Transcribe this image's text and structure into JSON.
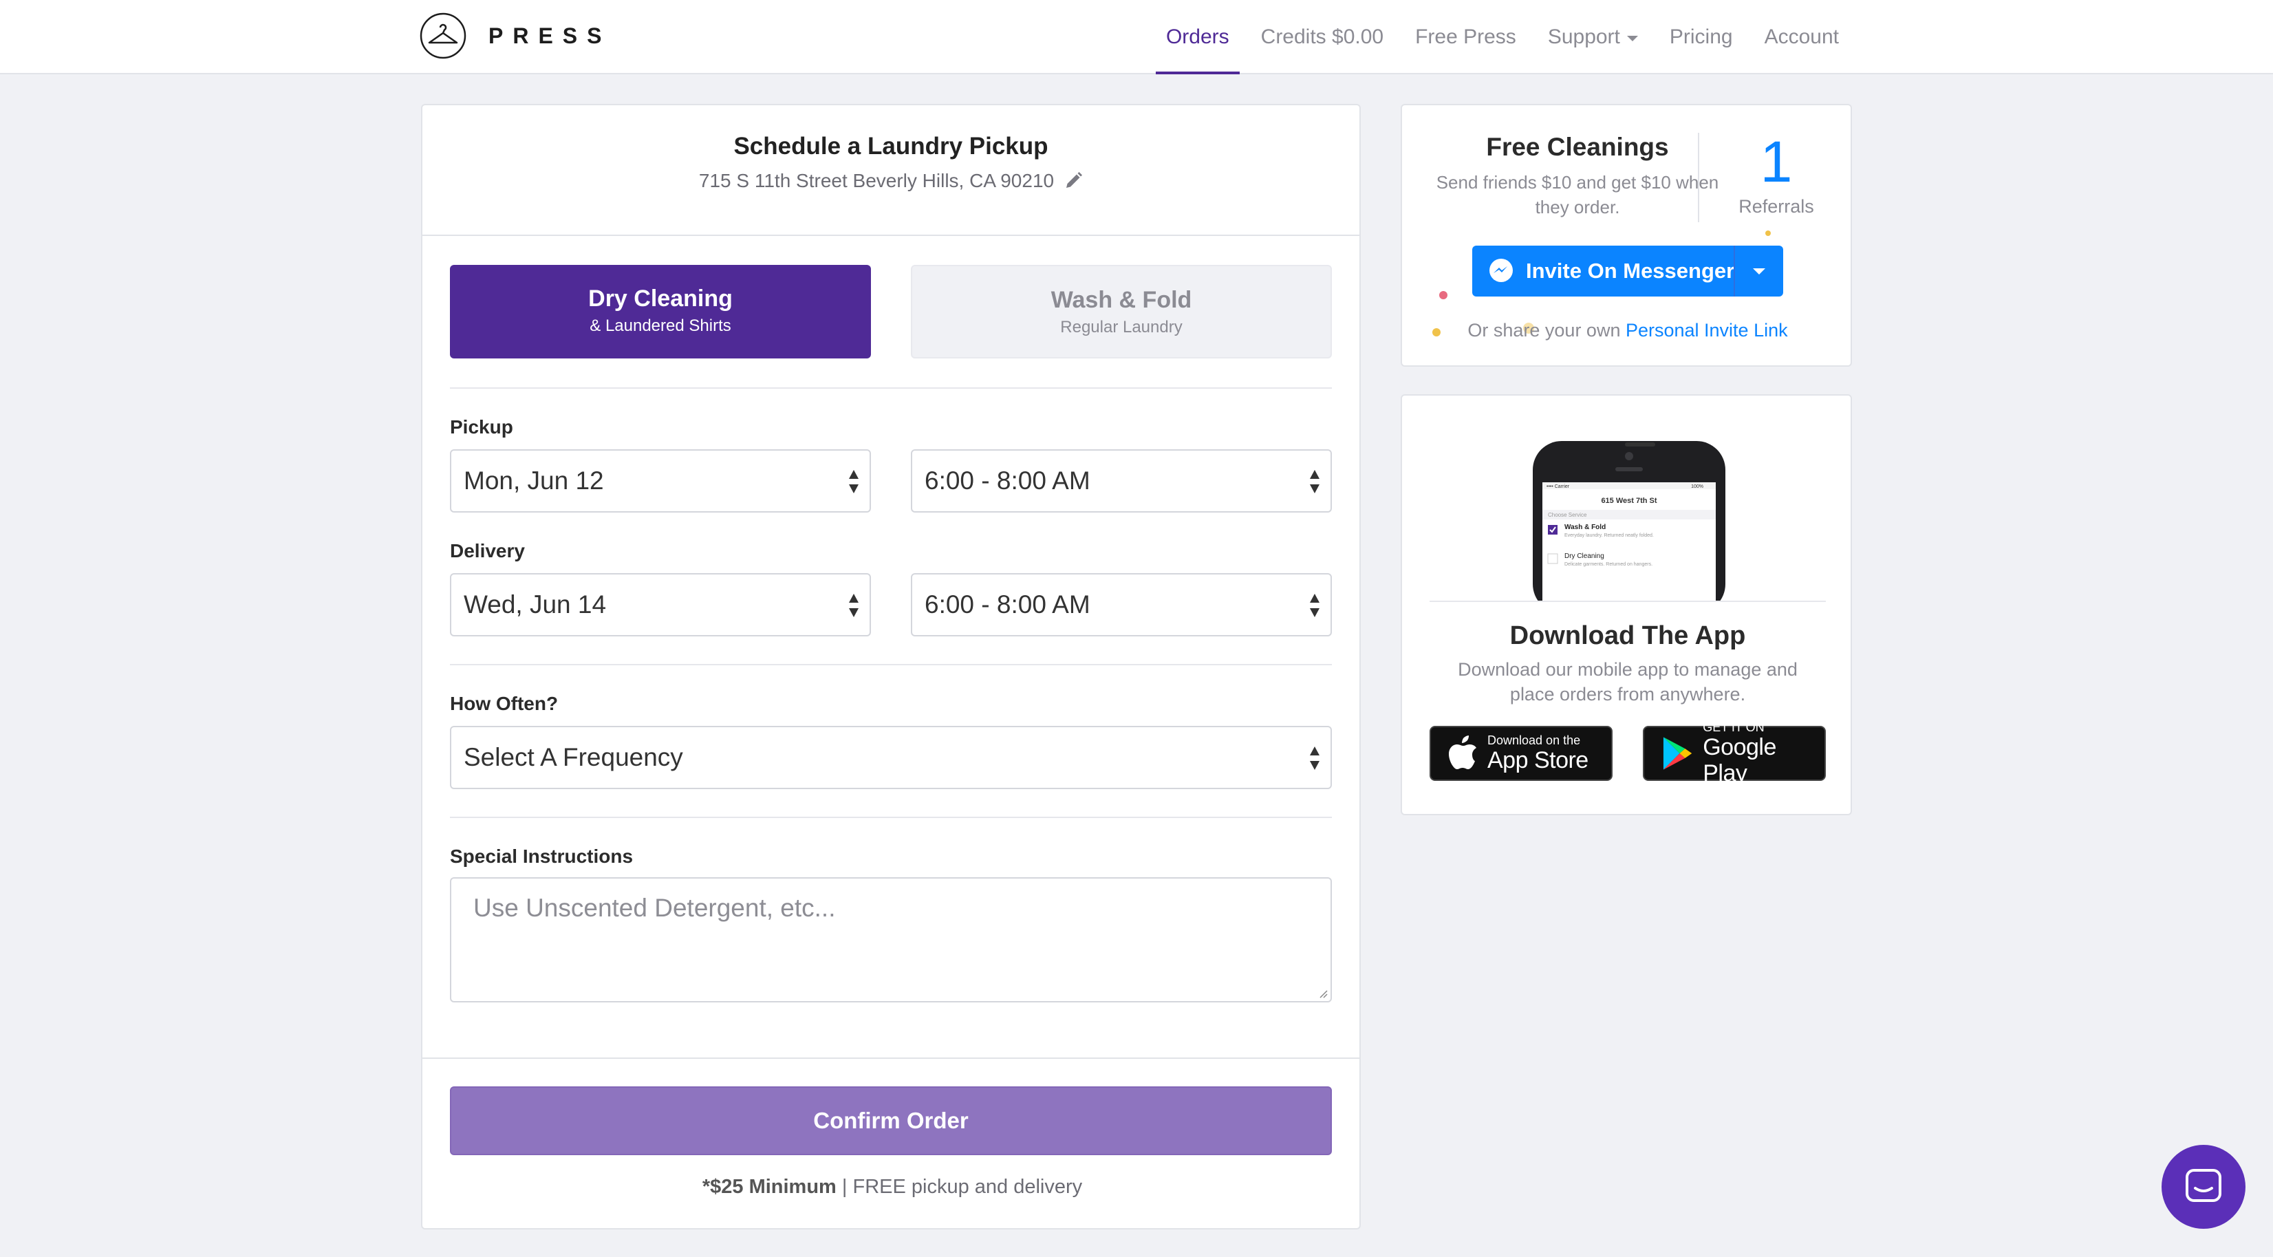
{
  "brand": {
    "name": "PRESS"
  },
  "nav": {
    "items": [
      {
        "label": "Orders",
        "active": true
      },
      {
        "label": "Credits $0.00"
      },
      {
        "label": "Free Press"
      },
      {
        "label": "Support",
        "has_dropdown": true
      },
      {
        "label": "Pricing"
      },
      {
        "label": "Account"
      }
    ]
  },
  "order": {
    "title": "Schedule a Laundry Pickup",
    "address": "715 S 11th Street Beverly Hills, CA 90210",
    "services": [
      {
        "title": "Dry Cleaning",
        "subtitle": "& Laundered Shirts",
        "selected": true
      },
      {
        "title": "Wash & Fold",
        "subtitle": "Regular Laundry",
        "selected": false
      }
    ],
    "pickup": {
      "label": "Pickup",
      "date": "Mon, Jun 12",
      "time": "6:00 - 8:00 AM"
    },
    "delivery": {
      "label": "Delivery",
      "date": "Wed, Jun 14",
      "time": "6:00 - 8:00 AM"
    },
    "frequency": {
      "label": "How Often?",
      "value": "Select A Frequency"
    },
    "instructions": {
      "label": "Special Instructions",
      "placeholder": "Use Unscented Detergent, etc..."
    },
    "confirm_label": "Confirm Order",
    "minimum_bold": "*$25 Minimum",
    "minimum_rest": " | FREE pickup and delivery"
  },
  "referral": {
    "title": "Free Cleanings",
    "description": "Send friends $10 and get $10 when they order.",
    "count": "1",
    "count_label": "Referrals",
    "messenger_label": "Invite On Messenger",
    "share_prefix": "Or share your own ",
    "share_link": "Personal Invite Link"
  },
  "app": {
    "title": "Download The App",
    "description": "Download our mobile app to manage and place orders from anywhere.",
    "appstore_small": "Download on the",
    "appstore_big": "App Store",
    "googleplay_small": "GET IT ON",
    "googleplay_big": "Google Play",
    "phone_screen": {
      "address": "615 West 7th St",
      "section": "Choose Service",
      "item1": "Wash & Fold",
      "item1_sub": "Everyday laundry. Returned neatly folded.",
      "item2": "Dry Cleaning",
      "item2_sub": "Delicate garments. Returned on hangers."
    }
  },
  "colors": {
    "brand_purple": "#4f2a96",
    "confirm_purple": "#8e74bf",
    "messenger_blue": "#0b84ff"
  }
}
